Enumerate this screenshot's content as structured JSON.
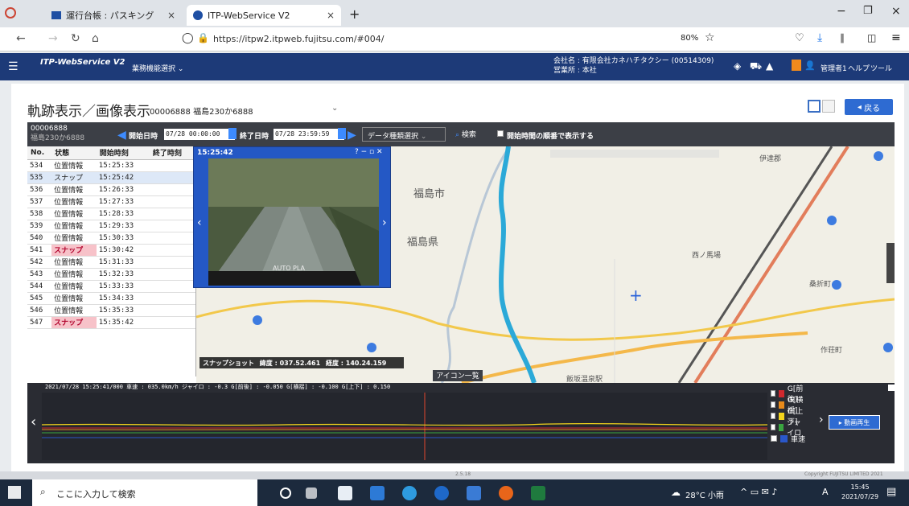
{
  "browser": {
    "tabs": [
      {
        "label": "運行台帳 : パスキング"
      },
      {
        "label": "ITP-WebService V2"
      }
    ],
    "address": "https://itpw2.itpweb.fujitsu.com/#004/",
    "zoom": "80%"
  },
  "app": {
    "brand": "ITP-WebService V2",
    "menu": "業務機能選択",
    "company": "会社名 : 有限会社カネハチタクシー (00514309)",
    "office": "営業所 : 本社",
    "user": "管理者1",
    "help": "ヘルプ",
    "tool": "ツール"
  },
  "page": {
    "title": "軌跡表示／画像表示",
    "vehicle": "00006888 福島230か6888",
    "back": "戻る"
  },
  "ctrl": {
    "vehicle_id": "00006888",
    "vehicle_plate": "福島230か6888",
    "start_label": "開始日時",
    "start_value": "07/28 00:00:00",
    "end_label": "終了日時",
    "end_value": "07/28 23:59:59",
    "data_select": "データ種類選択",
    "search": "検索",
    "checkbox_label": "開始時間の順番で表示する"
  },
  "table": {
    "headers": [
      "No.",
      "状態",
      "開始時刻",
      "終了時刻"
    ],
    "rows": [
      {
        "no": "534",
        "state": "位置情報",
        "start": "15:25:33",
        "end": "",
        "snap": false,
        "sel": false
      },
      {
        "no": "535",
        "state": "スナップ",
        "start": "15:25:42",
        "end": "",
        "snap": false,
        "sel": true
      },
      {
        "no": "536",
        "state": "位置情報",
        "start": "15:26:33",
        "end": "",
        "snap": false,
        "sel": false
      },
      {
        "no": "537",
        "state": "位置情報",
        "start": "15:27:33",
        "end": "",
        "snap": false,
        "sel": false
      },
      {
        "no": "538",
        "state": "位置情報",
        "start": "15:28:33",
        "end": "",
        "snap": false,
        "sel": false
      },
      {
        "no": "539",
        "state": "位置情報",
        "start": "15:29:33",
        "end": "",
        "snap": false,
        "sel": false
      },
      {
        "no": "540",
        "state": "位置情報",
        "start": "15:30:33",
        "end": "",
        "snap": false,
        "sel": false
      },
      {
        "no": "541",
        "state": "スナップ",
        "start": "15:30:42",
        "end": "",
        "snap": true,
        "sel": false
      },
      {
        "no": "542",
        "state": "位置情報",
        "start": "15:31:33",
        "end": "",
        "snap": false,
        "sel": false
      },
      {
        "no": "543",
        "state": "位置情報",
        "start": "15:32:33",
        "end": "",
        "snap": false,
        "sel": false
      },
      {
        "no": "544",
        "state": "位置情報",
        "start": "15:33:33",
        "end": "",
        "snap": false,
        "sel": false
      },
      {
        "no": "545",
        "state": "位置情報",
        "start": "15:34:33",
        "end": "",
        "snap": false,
        "sel": false
      },
      {
        "no": "546",
        "state": "位置情報",
        "start": "15:35:33",
        "end": "",
        "snap": false,
        "sel": false
      },
      {
        "no": "547",
        "state": "スナップ",
        "start": "15:35:42",
        "end": "",
        "snap": true,
        "sel": false
      }
    ]
  },
  "popup": {
    "time": "15:25:42",
    "overlay": "AUTO PLA"
  },
  "snapshot": {
    "label": "スナップショット",
    "lat": "緯度 : 037.52.461",
    "lon": "経度 : 140.24.159"
  },
  "map": {
    "labels": [
      {
        "t": "福島市"
      },
      {
        "t": "福島県"
      },
      {
        "t": "伊達郡"
      },
      {
        "t": "桑折町"
      },
      {
        "t": "飯坂温泉駅"
      },
      {
        "t": "西ノ馬場"
      },
      {
        "t": "作荘町"
      }
    ],
    "icon_list": "アイコン一覧"
  },
  "chart": {
    "info": "2021/07/28 15:25:41/000  車速 : 035.0km/h  ジャイロ : -0.3  G[前後] : -0.050  G[横揺] : -0.100  G[上下] : 0.150",
    "legend": [
      {
        "label": "G[前後]",
        "color": "#d0282e"
      },
      {
        "label": "G[横揺]",
        "color": "#e88a1a"
      },
      {
        "label": "G[上下]",
        "color": "#f2d31c"
      },
      {
        "label": "ジャイロ",
        "color": "#3aa640"
      },
      {
        "label": "車速",
        "color": "#2a57c9"
      }
    ],
    "play": "動画再生"
  },
  "footer": {
    "copyright": "Copyright FUJITSU LIMITED 2021",
    "ver": "2.5.18"
  },
  "taskbar": {
    "search": "ここに入力して検索",
    "weather": "28°C 小雨",
    "time": "15:45",
    "date": "2021/07/29"
  }
}
